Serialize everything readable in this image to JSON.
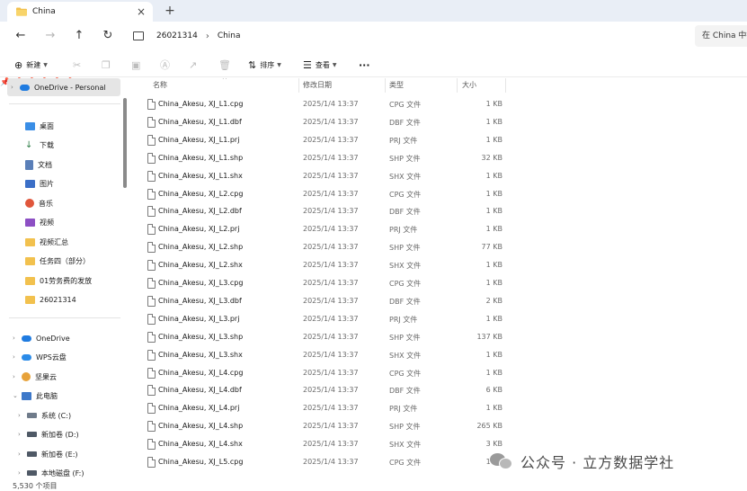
{
  "tab": {
    "title": "China",
    "close_glyph": "×",
    "new_tab_glyph": "+"
  },
  "nav": {
    "back": "←",
    "forward": "→",
    "up": "↑",
    "refresh": "↻"
  },
  "address": {
    "segments": [
      "26021314",
      "China"
    ],
    "separator": "›"
  },
  "search": {
    "placeholder": "在 China 中搜索"
  },
  "toolbar": {
    "new_label": "新建",
    "sort_label": "排序",
    "view_label": "查看",
    "more_glyph": "···"
  },
  "sidebar": {
    "onedrive_personal": "OneDrive - Personal",
    "quick_access": [
      {
        "label": "桌面",
        "color": "#3a8ee6"
      },
      {
        "label": "下载",
        "color": "#2d7d46"
      },
      {
        "label": "文档",
        "color": "#5a7fb8"
      },
      {
        "label": "图片",
        "color": "#3b6fc7"
      },
      {
        "label": "音乐",
        "color": "#e0563b"
      },
      {
        "label": "视频",
        "color": "#8d4fc4"
      }
    ],
    "folders": [
      "视频汇总",
      "任务四（部分）",
      "01劳务费的发放",
      "26021314"
    ],
    "roots": [
      {
        "label": "OneDrive",
        "color": "#1f7be0"
      },
      {
        "label": "WPS云盘",
        "color": "#2b8be8"
      },
      {
        "label": "坚果云",
        "color": "#e7a23a"
      },
      {
        "label": "此电脑",
        "color": "#3d78c9"
      }
    ],
    "drives": [
      "系统 (C:)",
      "新加卷 (D:)",
      "新加卷 (E:)",
      "本地磁盘 (F:)"
    ]
  },
  "columns": {
    "name": "名称",
    "date": "修改日期",
    "type": "类型",
    "size": "大小"
  },
  "files": [
    {
      "name": "China_Akesu, XJ_L1.cpg",
      "date": "2025/1/4 13:37",
      "type": "CPG 文件",
      "size": "1 KB"
    },
    {
      "name": "China_Akesu, XJ_L1.dbf",
      "date": "2025/1/4 13:37",
      "type": "DBF 文件",
      "size": "1 KB"
    },
    {
      "name": "China_Akesu, XJ_L1.prj",
      "date": "2025/1/4 13:37",
      "type": "PRJ 文件",
      "size": "1 KB"
    },
    {
      "name": "China_Akesu, XJ_L1.shp",
      "date": "2025/1/4 13:37",
      "type": "SHP 文件",
      "size": "32 KB"
    },
    {
      "name": "China_Akesu, XJ_L1.shx",
      "date": "2025/1/4 13:37",
      "type": "SHX 文件",
      "size": "1 KB"
    },
    {
      "name": "China_Akesu, XJ_L2.cpg",
      "date": "2025/1/4 13:37",
      "type": "CPG 文件",
      "size": "1 KB"
    },
    {
      "name": "China_Akesu, XJ_L2.dbf",
      "date": "2025/1/4 13:37",
      "type": "DBF 文件",
      "size": "1 KB"
    },
    {
      "name": "China_Akesu, XJ_L2.prj",
      "date": "2025/1/4 13:37",
      "type": "PRJ 文件",
      "size": "1 KB"
    },
    {
      "name": "China_Akesu, XJ_L2.shp",
      "date": "2025/1/4 13:37",
      "type": "SHP 文件",
      "size": "77 KB"
    },
    {
      "name": "China_Akesu, XJ_L2.shx",
      "date": "2025/1/4 13:37",
      "type": "SHX 文件",
      "size": "1 KB"
    },
    {
      "name": "China_Akesu, XJ_L3.cpg",
      "date": "2025/1/4 13:37",
      "type": "CPG 文件",
      "size": "1 KB"
    },
    {
      "name": "China_Akesu, XJ_L3.dbf",
      "date": "2025/1/4 13:37",
      "type": "DBF 文件",
      "size": "2 KB"
    },
    {
      "name": "China_Akesu, XJ_L3.prj",
      "date": "2025/1/4 13:37",
      "type": "PRJ 文件",
      "size": "1 KB"
    },
    {
      "name": "China_Akesu, XJ_L3.shp",
      "date": "2025/1/4 13:37",
      "type": "SHP 文件",
      "size": "137 KB"
    },
    {
      "name": "China_Akesu, XJ_L3.shx",
      "date": "2025/1/4 13:37",
      "type": "SHX 文件",
      "size": "1 KB"
    },
    {
      "name": "China_Akesu, XJ_L4.cpg",
      "date": "2025/1/4 13:37",
      "type": "CPG 文件",
      "size": "1 KB"
    },
    {
      "name": "China_Akesu, XJ_L4.dbf",
      "date": "2025/1/4 13:37",
      "type": "DBF 文件",
      "size": "6 KB"
    },
    {
      "name": "China_Akesu, XJ_L4.prj",
      "date": "2025/1/4 13:37",
      "type": "PRJ 文件",
      "size": "1 KB"
    },
    {
      "name": "China_Akesu, XJ_L4.shp",
      "date": "2025/1/4 13:37",
      "type": "SHP 文件",
      "size": "265 KB"
    },
    {
      "name": "China_Akesu, XJ_L4.shx",
      "date": "2025/1/4 13:37",
      "type": "SHX 文件",
      "size": "3 KB"
    },
    {
      "name": "China_Akesu, XJ_L5.cpg",
      "date": "2025/1/4 13:37",
      "type": "CPG 文件",
      "size": "1 KB"
    }
  ],
  "status": {
    "item_count": "5,530 个项目"
  },
  "watermark": {
    "text": "公众号 · 立方数据学社"
  }
}
